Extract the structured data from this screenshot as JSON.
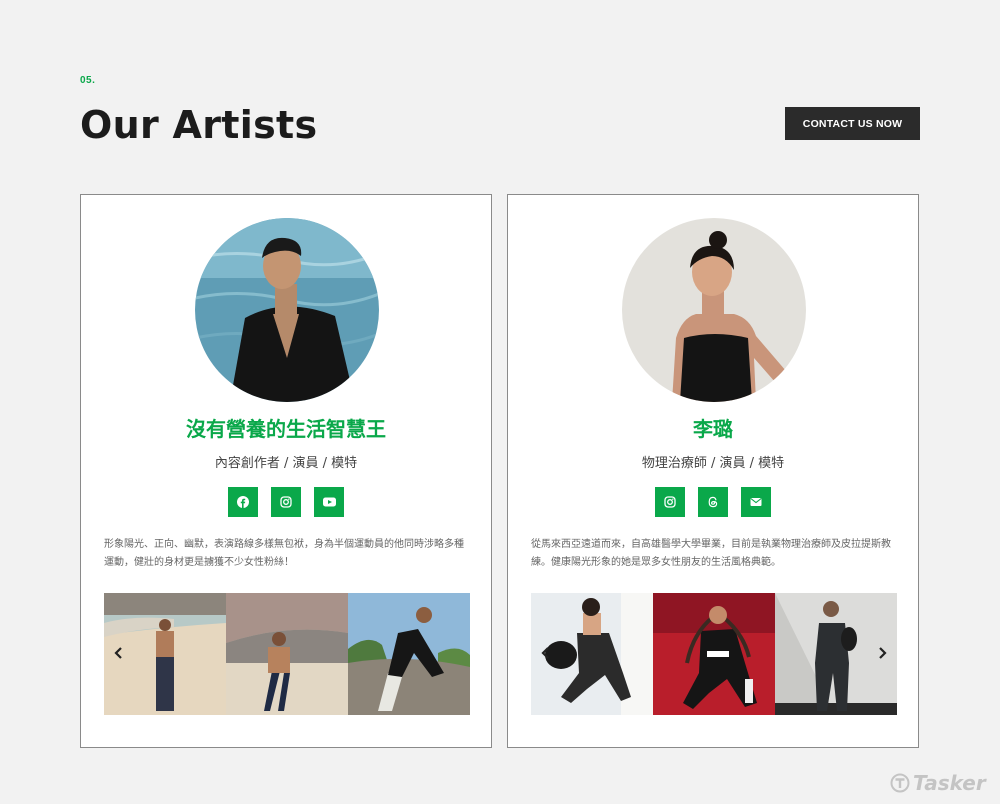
{
  "section": {
    "number": "05.",
    "title": "Our Artists",
    "contact_button": "CONTACT US NOW"
  },
  "artists": [
    {
      "name": "沒有營養的生活智慧王",
      "role": "內容創作者 / 演員 / 模特",
      "socials": [
        "facebook-icon",
        "instagram-icon",
        "youtube-icon"
      ],
      "bio": "形象陽光、正向、幽默，表演路線多樣無包袱，身為半個運動員的他同時涉略多種運動，健壯的身材更是擄獲不少女性粉絲！"
    },
    {
      "name": "李璐",
      "role": "物理治療師 / 演員 / 模特",
      "socials": [
        "instagram-icon",
        "threads-icon",
        "email-icon"
      ],
      "bio": "從馬來西亞遠道而來，自高雄醫學大學畢業，目前是執業物理治療師及皮拉提斯教練。健康陽光形象的她是眾多女性朋友的生活風格典範。"
    }
  ],
  "watermark": "Tasker",
  "colors": {
    "accent": "#0aa84a",
    "dark_button": "#2b2b2b",
    "background": "#f2f2f2"
  }
}
